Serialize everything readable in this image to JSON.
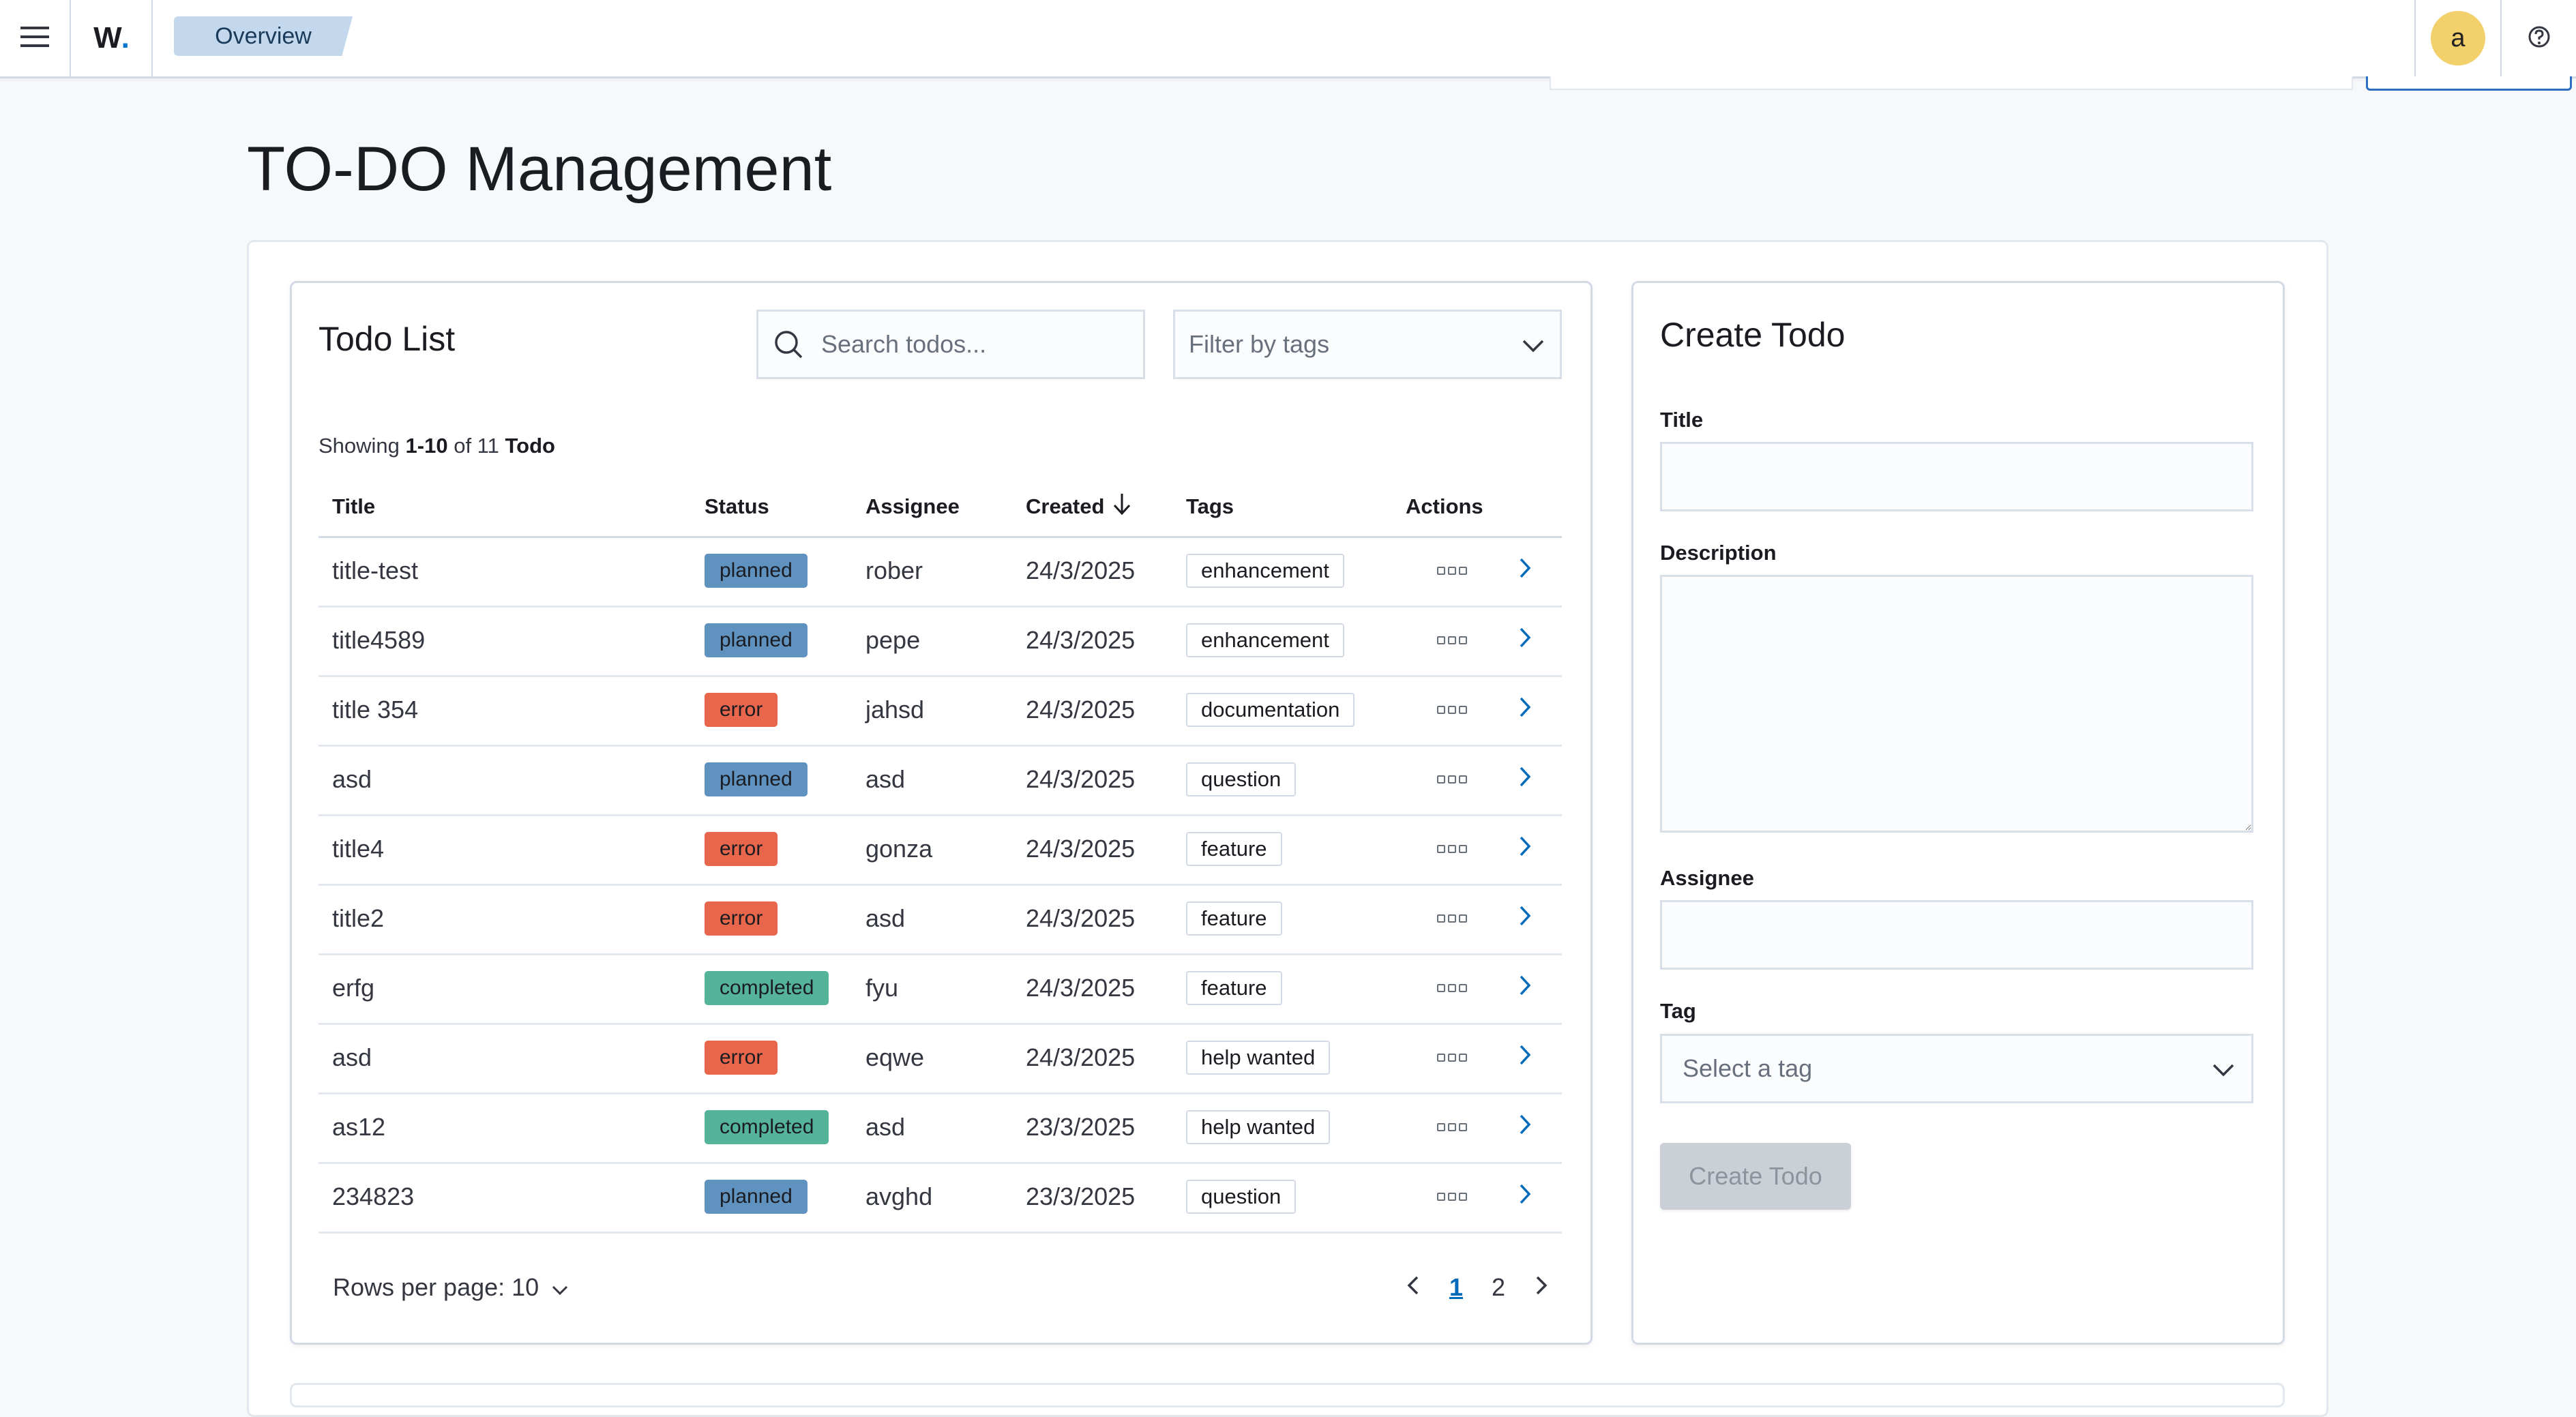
{
  "header": {
    "logo_letter": "W",
    "logo_dot": ".",
    "breadcrumb": "Overview",
    "avatar_initial": "a",
    "icons": [
      "menu-icon",
      "help-icon"
    ]
  },
  "page": {
    "title": "TO-DO Management"
  },
  "todo_list": {
    "title": "Todo List",
    "search_placeholder": "Search todos...",
    "filter_placeholder": "Filter by tags",
    "showing": {
      "prefix": "Showing",
      "range": "1-10",
      "of": "of 11",
      "entity": "Todo"
    },
    "columns": {
      "title": "Title",
      "status": "Status",
      "assignee": "Assignee",
      "created": "Created",
      "tags": "Tags",
      "actions": "Actions"
    },
    "rows": [
      {
        "title": "title-test",
        "status": "planned",
        "assignee": "rober",
        "created": "24/3/2025",
        "tag": "enhancement"
      },
      {
        "title": "title4589",
        "status": "planned",
        "assignee": "pepe",
        "created": "24/3/2025",
        "tag": "enhancement"
      },
      {
        "title": "title 354",
        "status": "error",
        "assignee": "jahsd",
        "created": "24/3/2025",
        "tag": "documentation"
      },
      {
        "title": "asd",
        "status": "planned",
        "assignee": "asd",
        "created": "24/3/2025",
        "tag": "question"
      },
      {
        "title": "title4",
        "status": "error",
        "assignee": "gonza",
        "created": "24/3/2025",
        "tag": "feature"
      },
      {
        "title": "title2",
        "status": "error",
        "assignee": "asd",
        "created": "24/3/2025",
        "tag": "feature"
      },
      {
        "title": "erfg",
        "status": "completed",
        "assignee": "fyu",
        "created": "24/3/2025",
        "tag": "feature"
      },
      {
        "title": "asd",
        "status": "error",
        "assignee": "eqwe",
        "created": "24/3/2025",
        "tag": "help wanted"
      },
      {
        "title": "as12",
        "status": "completed",
        "assignee": "asd",
        "created": "23/3/2025",
        "tag": "help wanted"
      },
      {
        "title": "234823",
        "status": "planned",
        "assignee": "avghd",
        "created": "23/3/2025",
        "tag": "question"
      }
    ],
    "status_colors": {
      "planned": "#6092c0",
      "error": "#e7664c",
      "completed": "#54b399"
    },
    "rows_per_page_label": "Rows per page: 10",
    "pages": [
      "1",
      "2"
    ],
    "active_page": "1"
  },
  "create_todo": {
    "title": "Create Todo",
    "labels": {
      "title": "Title",
      "description": "Description",
      "assignee": "Assignee",
      "tag": "Tag"
    },
    "values": {
      "title": "",
      "description": "",
      "assignee": ""
    },
    "tag_placeholder": "Select a tag",
    "submit_label": "Create Todo"
  }
}
